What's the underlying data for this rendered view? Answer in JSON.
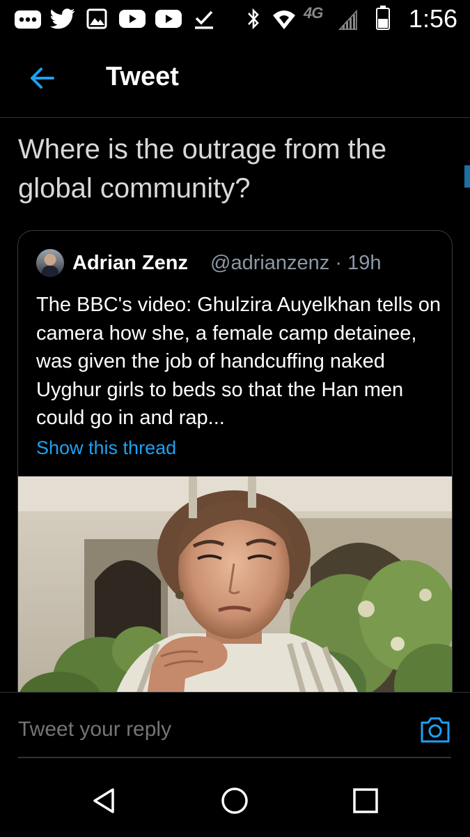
{
  "status_bar": {
    "time": "1:56",
    "network_label": "4G",
    "icons": [
      "more-notifications-icon",
      "twitter-bird-icon",
      "image-icon",
      "youtube-icon",
      "youtube-icon",
      "checkmark-icon",
      "bluetooth-icon",
      "wifi-icon",
      "network-4g-lte-icon",
      "signal-icon",
      "battery-icon"
    ]
  },
  "header": {
    "title": "Tweet"
  },
  "tweet": {
    "text": "Where is the outrage from the global community?"
  },
  "quoted_tweet": {
    "author_name": "Adrian Zenz",
    "handle_time": "@adrianzenz · 19h",
    "text": "The BBC's video: Ghulzira Auyelkhan tells on camera how she, a female camp detainee, was given the job of handcuffing naked Uyghur girls to beds so that the Han men could go in and rap...",
    "show_thread": "Show this thread"
  },
  "reply": {
    "placeholder": "Tweet your reply"
  },
  "colors": {
    "accent": "#1da1f2",
    "background": "#000000",
    "muted": "#8b98a5",
    "border": "#2f3336"
  }
}
